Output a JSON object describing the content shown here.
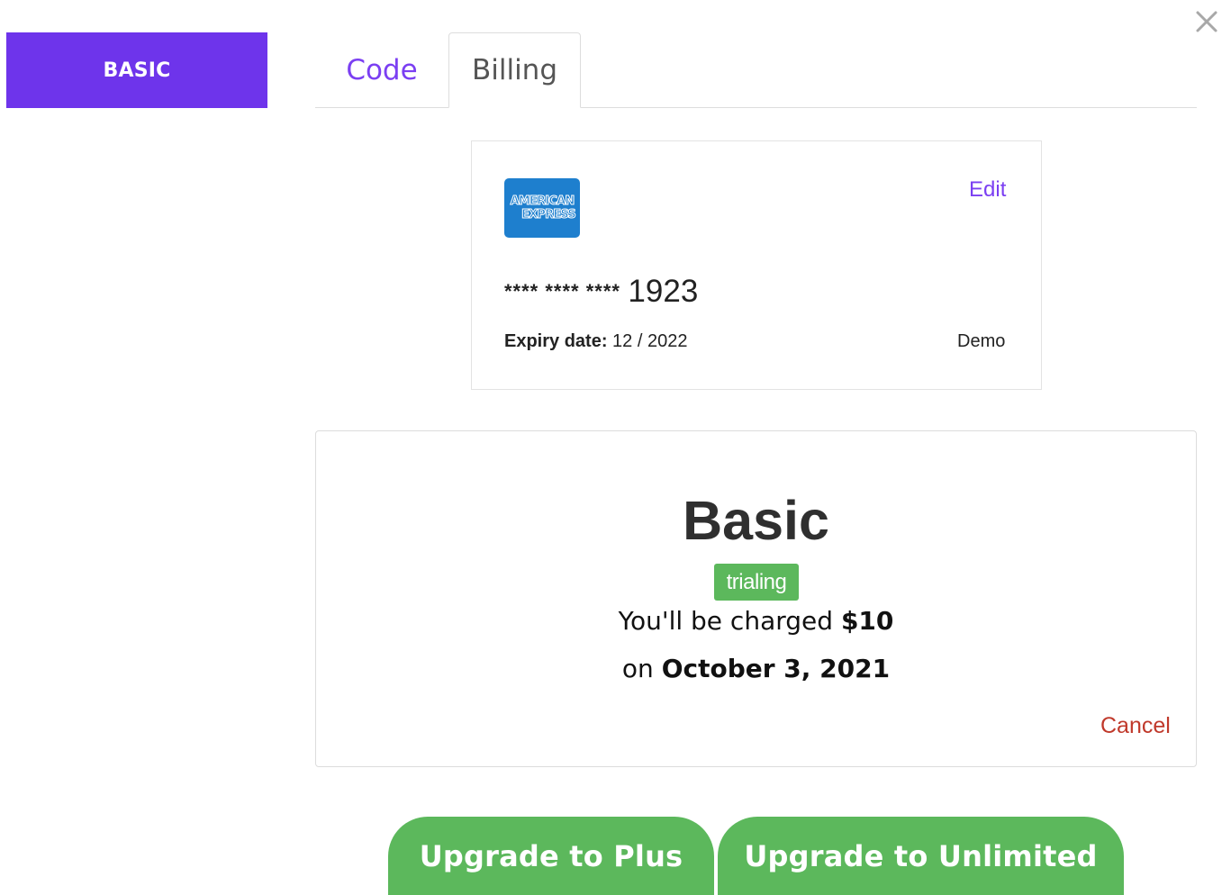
{
  "plan_badge": {
    "label": "BASIC"
  },
  "tabs": [
    {
      "label": "Code",
      "active": false
    },
    {
      "label": "Billing",
      "active": true
    }
  ],
  "card": {
    "brand_line1": "AMERICAN",
    "brand_line2": "EXPRESS",
    "edit_label": "Edit",
    "masked": "**** **** ****",
    "last4": "1923",
    "expiry_label": "Expiry date:",
    "expiry_value": "12 / 2022",
    "holder": "Demo"
  },
  "plan": {
    "name": "Basic",
    "status": "trialing",
    "charge_prefix": "You'll be charged",
    "charge_amount": "$10",
    "date_prefix": "on",
    "charge_date": "October 3, 2021",
    "cancel_label": "Cancel"
  },
  "actions": {
    "upgrade_plus": "Upgrade to Plus",
    "upgrade_unlimited": "Upgrade to Unlimited"
  },
  "colors": {
    "accent_purple": "#6e34eb",
    "link_purple": "#7b3ff2",
    "success_green": "#5cb85c",
    "danger_red": "#c0392b",
    "amex_blue": "#1e7fce"
  }
}
